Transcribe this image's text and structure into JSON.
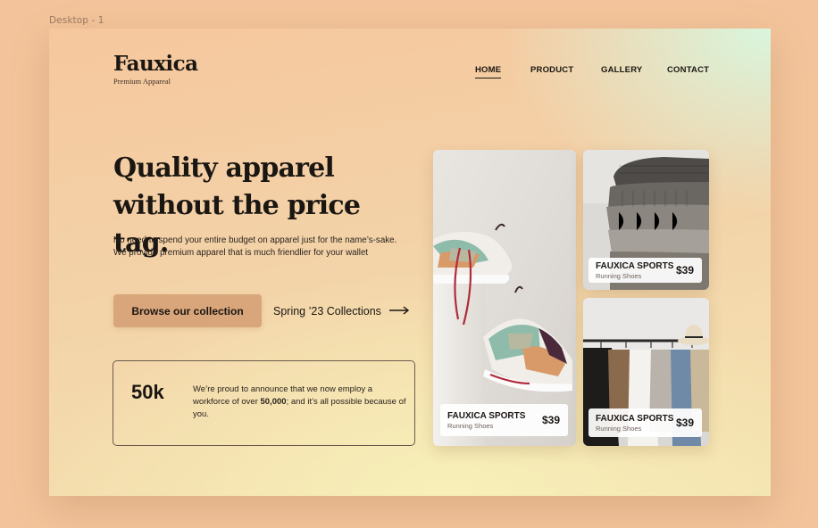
{
  "frame": {
    "label": "Desktop - 1"
  },
  "brand": {
    "name": "Fauxica",
    "tagline": "Premium Appareal"
  },
  "nav": {
    "items": [
      {
        "label": "HOME",
        "active": true
      },
      {
        "label": "PRODUCT",
        "active": false
      },
      {
        "label": "GALLERY",
        "active": false
      },
      {
        "label": "CONTACT",
        "active": false
      }
    ]
  },
  "hero": {
    "headline_line1": "Quality apparel",
    "headline_line2": "without the price tag.",
    "subtext": "No need to spend your entire budget on apparel just for the name’s-sake. We provide premium apparel that is much friendlier for your wallet",
    "primary_button": "Browse our collection",
    "secondary_link": "Spring ’23 Collections",
    "arrow_icon": "long-arrow-right-icon"
  },
  "stat": {
    "number": "50k",
    "text_before": "We’re proud to announce that we now employ a workforce of over ",
    "text_bold": "50,000",
    "text_after": "; and it’s all possible because of you."
  },
  "products": [
    {
      "image": "sneakers-on-box",
      "brand": "FAUXICA SPORTS",
      "category": "Running Shoes",
      "price": "$39"
    },
    {
      "image": "stacked-knit-sweaters",
      "brand": "FAUXICA SPORTS",
      "category": "Running Shoes",
      "price": "$39"
    },
    {
      "image": "clothing-rack",
      "brand": "FAUXICA SPORTS",
      "category": "Running Shoes",
      "price": "$39"
    }
  ],
  "colors": {
    "accent": "#d9a57a",
    "text": "#1a1612",
    "outer_bg": "#f3c49b"
  }
}
